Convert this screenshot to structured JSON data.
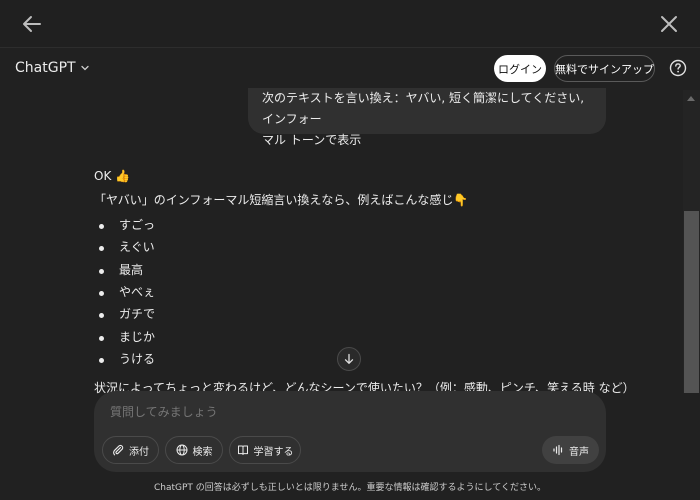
{
  "header": {
    "model": "ChatGPT",
    "login": "ログイン",
    "signup": "無料でサインアップ"
  },
  "conversation": {
    "user_message": [
      "次のテキストを言い換え：ヤバい, 短く簡潔にしてください, インフォー",
      "マル トーンで表示"
    ],
    "assistant": {
      "intro": "OK 👍",
      "lead": "「ヤバい」のインフォーマル短縮言い換えなら、例えばこんな感じ👇",
      "items": [
        "すごっ",
        "えぐい",
        "最高",
        "やべぇ",
        "ガチで",
        "まじか",
        "うける"
      ],
      "closing": "状況によってちょっと変わるけど、どんなシーンで使いたい？（例：感動、ピンチ、笑える時 など）"
    }
  },
  "composer": {
    "placeholder": "質問してみましょう",
    "attach": "添付",
    "search": "検索",
    "study": "学習する",
    "voice": "音声"
  },
  "footer": {
    "disclaimer": "ChatGPT の回答は必ずしも正しいとは限りません。重要な情報は確認するようにしてください。"
  },
  "icons": {
    "back": "arrow-left-icon",
    "close": "close-icon",
    "help": "help-circle-icon",
    "scroll": "arrow-down-icon"
  }
}
